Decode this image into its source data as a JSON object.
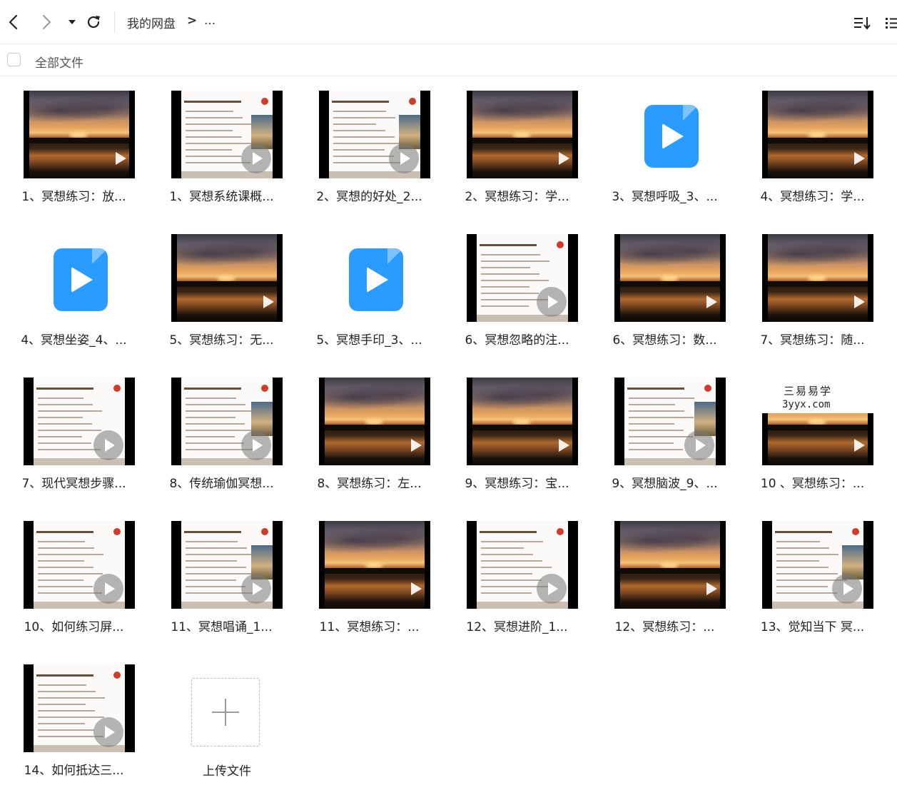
{
  "toolbar": {
    "back_icon": "chevron-left-icon",
    "forward_icon": "chevron-right-icon",
    "history_icon": "caret-down-icon",
    "refresh_icon": "refresh-icon",
    "breadcrumb_root": "我的网盘",
    "breadcrumb_sep": ">",
    "breadcrumb_more": "...",
    "sort_icon": "sort-icon",
    "view_icon": "list-view-icon"
  },
  "select_bar": {
    "all_files_label": "全部文件"
  },
  "files": [
    {
      "name": "1、冥想练习：放...",
      "thumb": "sunset"
    },
    {
      "name": "1、冥想系统课概...",
      "thumb": "doc"
    },
    {
      "name": "2、冥想的好处_2...",
      "thumb": "doc"
    },
    {
      "name": "2、冥想练习：学...",
      "thumb": "sunset"
    },
    {
      "name": "3、冥想呼吸_3、...",
      "thumb": "blue"
    },
    {
      "name": "4、冥想练习：学...",
      "thumb": "sunset"
    },
    {
      "name": "4、冥想坐姿_4、...",
      "thumb": "blue"
    },
    {
      "name": "5、冥想练习：无...",
      "thumb": "sunset"
    },
    {
      "name": "5、冥想手印_3、...",
      "thumb": "blue"
    },
    {
      "name": "6、冥想忽略的注...",
      "thumb": "doc"
    },
    {
      "name": "6、冥想练习：数...",
      "thumb": "sunset"
    },
    {
      "name": "7、冥想练习：随...",
      "thumb": "sunset"
    },
    {
      "name": "7、现代冥想步骤...",
      "thumb": "doc"
    },
    {
      "name": "8、传统瑜伽冥想...",
      "thumb": "doc"
    },
    {
      "name": "8、冥想练习：左...",
      "thumb": "sunset"
    },
    {
      "name": "9、冥想练习：宝...",
      "thumb": "sunset"
    },
    {
      "name": "9、冥想脑波_9、...",
      "thumb": "doc"
    },
    {
      "name": "10 、冥想练习：...",
      "thumb": "yyx",
      "overlay_line1": "三易易学",
      "overlay_line2": "3yyx.com"
    },
    {
      "name": "10、如何练习屏...",
      "thumb": "doc"
    },
    {
      "name": "11、冥想唱诵_1...",
      "thumb": "doc"
    },
    {
      "name": "11、冥想练习：...",
      "thumb": "sunset"
    },
    {
      "name": "12、冥想进阶_1...",
      "thumb": "doc"
    },
    {
      "name": "12、冥想练习：...",
      "thumb": "sunset"
    },
    {
      "name": "13、觉知当下 冥...",
      "thumb": "doc"
    },
    {
      "name": "14、如何抵达三...",
      "thumb": "doc"
    }
  ],
  "upload": {
    "label": "上传文件",
    "icon": "plus-icon"
  }
}
